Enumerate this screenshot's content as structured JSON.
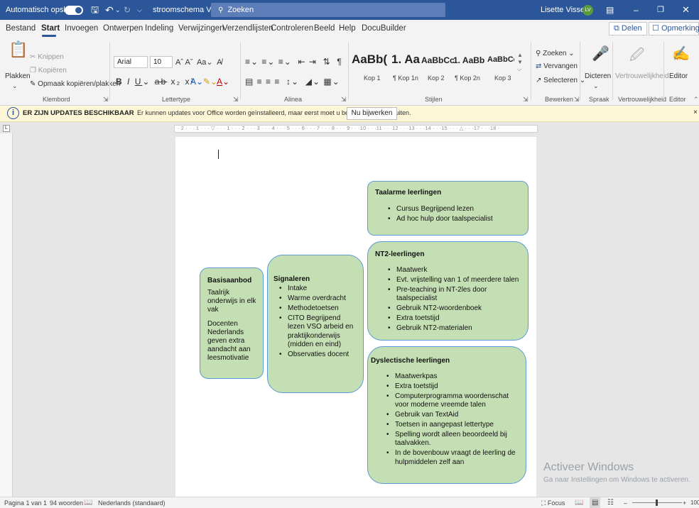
{
  "titlebar": {
    "autosave_label": "Automatisch opslaan",
    "autosave_state": "Aan",
    "doc_title": "stroomschema VMBO - Opgeslagen",
    "search_placeholder": "Zoeken",
    "user_name": "Lisette Visser",
    "user_initials": "LV"
  },
  "menu": {
    "tabs": [
      "Bestand",
      "Start",
      "Invoegen",
      "Ontwerpen",
      "Indeling",
      "Verwijzingen",
      "Verzendlijsten",
      "Controleren",
      "Beeld",
      "Help",
      "DocuBuilder"
    ],
    "active_tab": "Start",
    "share_label": "Delen",
    "comments_label": "Opmerkingen"
  },
  "ribbon": {
    "clipboard": {
      "paste": "Plakken",
      "cut": "Knippen",
      "copy": "Kopiëren",
      "format_painter": "Opmaak kopiëren/plakken",
      "group": "Klembord"
    },
    "font": {
      "name": "Arial",
      "size": "10",
      "group": "Lettertype"
    },
    "paragraph": {
      "group": "Alinea"
    },
    "styles": {
      "group": "Stijlen",
      "items": [
        {
          "preview": "AaBb(",
          "name": "Kop 1"
        },
        {
          "preview": "1. Aa",
          "name": "¶ Kop 1n"
        },
        {
          "preview": "AaBbCc",
          "name": "Kop 2"
        },
        {
          "preview": "1. AaBb",
          "name": "¶ Kop 2n"
        },
        {
          "preview": "AaBbCcI",
          "name": "Kop 3"
        }
      ]
    },
    "edit": {
      "find": "Zoeken",
      "replace": "Vervangen",
      "select": "Selecteren",
      "group": "Bewerken"
    },
    "voice": {
      "dictate": "Dicteren",
      "group": "Spraak"
    },
    "sensitivity": {
      "label": "Vertrouwelijkheid",
      "group": "Vertrouwelijkheid"
    },
    "editor": {
      "label": "Editor",
      "group": "Editor"
    }
  },
  "infobar": {
    "title": "ER ZIJN UPDATES BESCHIKBAAR",
    "message": "Er kunnen updates voor Office worden geïnstalleerd, maar eerst moet u bepaalde apps afsluiten.",
    "button": "Nu bijwerken"
  },
  "ruler": {
    "marks": "· 2 · · · 1 · · · ▽ · · · 1 · · · 2 · · · 3 · · · 4 · · · 5 · · · 6 · · · 7 · · · 8 · · · 9 · · ·10 · · ·11 · · ·12 · · ·13 · · ·14 · · ·15 · · · △ · · ·17 · · ·18 ·"
  },
  "shapes": {
    "basis": {
      "title": "Basisaanbod",
      "p1": "Taalrijk onderwijs in elk vak",
      "p2": "Docenten Nederlands geven extra aandacht aan leesmotivatie"
    },
    "signal": {
      "title": "Signaleren",
      "items": [
        "Intake",
        "Warme overdracht",
        "Methodetoetsen",
        "CITO Begrijpend lezen VSO arbeid en praktijkonderwijs (midden en eind)",
        "Observaties docent"
      ]
    },
    "taalarm": {
      "title": "Taalarme leerlingen",
      "items": [
        "Cursus Begrijpend lezen",
        "Ad hoc hulp door taalspecialist"
      ]
    },
    "nt2": {
      "title": "NT2-leerlingen",
      "items": [
        "Maatwerk",
        "Evt. vrijstelling van 1 of meerdere talen",
        "Pre-teaching in NT-2les door taalspecialist",
        "Gebruik NT2-woordenboek",
        "Extra toetstijd",
        "Gebruik NT2-materialen"
      ]
    },
    "dys": {
      "title": "Dyslectische leerlingen",
      "items": [
        "Maatwerkpas",
        "Extra toetstijd",
        "Computerprogramma woordenschat voor moderne vreemde talen",
        "Gebruik van TextAid",
        "Toetsen in aangepast lettertype",
        "Spelling wordt alleen beoordeeld bij taalvakken.",
        "In de bovenbouw vraagt de leerling de hulpmiddelen zelf aan"
      ]
    }
  },
  "watermark": {
    "title": "Activeer Windows",
    "subtitle": "Ga naar Instellingen om Windows te activeren."
  },
  "status": {
    "page": "Pagina 1 van 1",
    "words": "94 woorden",
    "language": "Nederlands (standaard)",
    "focus": "Focus",
    "zoom": "100"
  },
  "colors": {
    "accent": "#2b579a",
    "shape_fill": "#c5dfb4",
    "shape_border": "#5b9bd5",
    "infobar": "#fdf7d8"
  },
  "icons": [
    "save-icon",
    "undo-icon",
    "redo-icon",
    "customize-icon",
    "search-icon",
    "ribbon-display-icon",
    "minimize-icon",
    "restore-icon",
    "close-icon",
    "share-icon",
    "comments-icon",
    "paste-icon",
    "cut-icon",
    "copy-icon",
    "format-painter-icon",
    "find-icon",
    "replace-icon",
    "select-icon",
    "microphone-icon",
    "sensitivity-icon",
    "editor-icon",
    "info-icon",
    "dialog-launcher-icon",
    "read-mode-icon",
    "print-layout-icon",
    "web-layout-icon"
  ]
}
